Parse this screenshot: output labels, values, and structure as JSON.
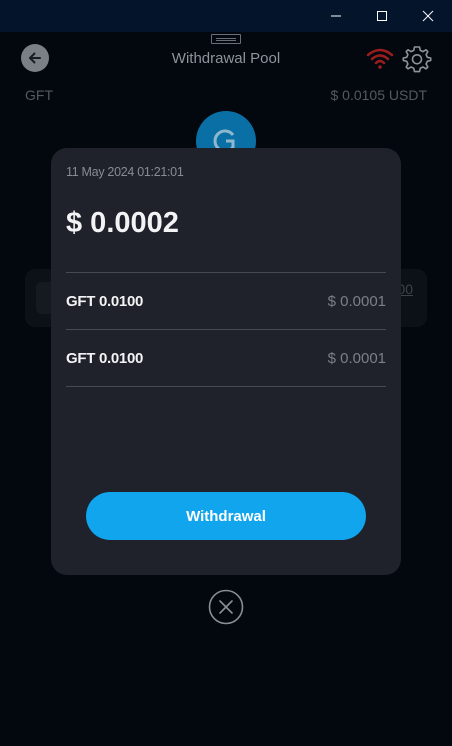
{
  "window": {
    "controls": [
      "minimize",
      "maximize",
      "close"
    ]
  },
  "header": {
    "title": "Withdrawal Pool",
    "icons": [
      "back-arrow-icon",
      "wifi-icon",
      "gear-icon"
    ],
    "status_color": "#d32b2b"
  },
  "asset": {
    "name": "GFT",
    "price": "$ 0.0105 USDT",
    "card_text": "00"
  },
  "modal": {
    "date": "11 May 2024 01:21:01",
    "total": "$ 0.0002",
    "rows": [
      {
        "label": "GFT 0.0100",
        "value": "$ 0.0001"
      },
      {
        "label": "GFT 0.0100",
        "value": "$ 0.0001"
      }
    ],
    "button_label": "Withdrawal"
  },
  "colors": {
    "accent": "#10a5ed",
    "modal_bg": "#1f222a",
    "page_bg": "#03080f"
  }
}
